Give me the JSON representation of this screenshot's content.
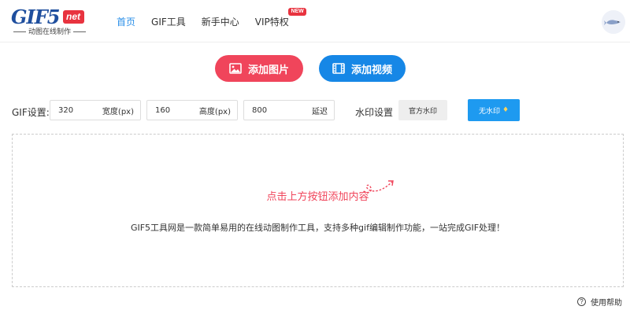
{
  "brand": {
    "logo_main": "GIF5",
    "logo_net": "net",
    "tagline": "动图在线制作"
  },
  "nav": {
    "items": [
      {
        "label": "首页",
        "active": true
      },
      {
        "label": "GIF工具",
        "active": false
      },
      {
        "label": "新手中心",
        "active": false
      },
      {
        "label": "VIP特权",
        "active": false
      }
    ],
    "vip_badge": "NEW"
  },
  "actions": {
    "add_image": "添加图片",
    "add_video": "添加视频"
  },
  "settings": {
    "label": "GIF设置:",
    "width": {
      "value": "320",
      "unit": "宽度(px)"
    },
    "height": {
      "value": "160",
      "unit": "高度(px)"
    },
    "delay": {
      "value": "800",
      "unit": "延迟"
    },
    "watermark_label": "水印设置",
    "watermark_official": "官方水印",
    "watermark_none": "无水印"
  },
  "dropzone": {
    "hint": "点击上方按钮添加内容",
    "description": "GIF5工具网是一款简单易用的在线动图制作工具，支持多种gif编辑制作功能，一站完成GIF处理！"
  },
  "help": {
    "label": "使用帮助"
  },
  "colors": {
    "accent_blue": "#1687e6",
    "accent_red": "#f0455b",
    "brand_blue": "#1f4f9e"
  }
}
